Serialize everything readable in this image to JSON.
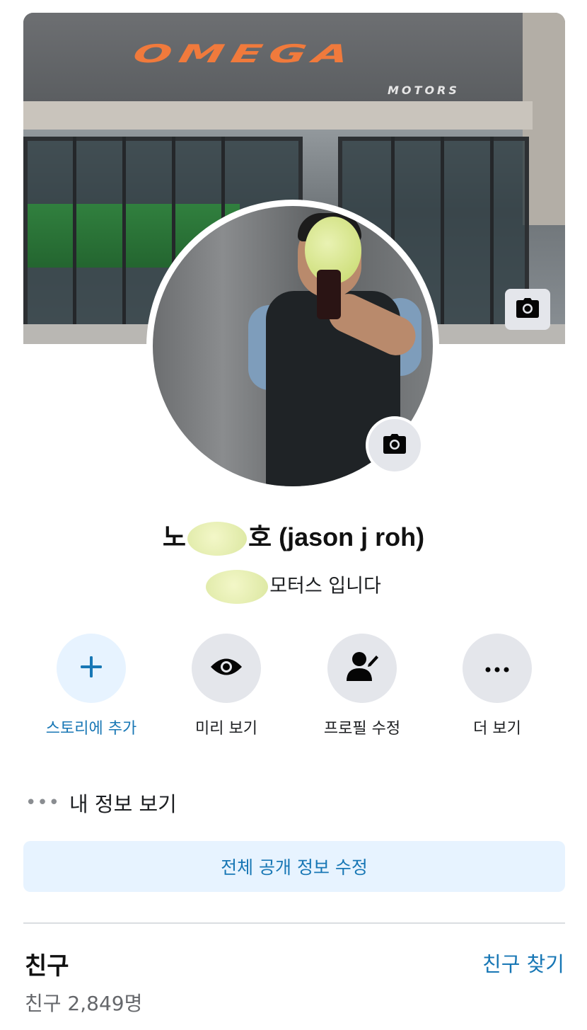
{
  "cover": {
    "logo_text": "OMEGA",
    "logo_sub": "MOTORS"
  },
  "profile": {
    "name_prefix": "노",
    "name_suffix": "호 (jason j roh)",
    "bio_suffix": "모터스 입니다"
  },
  "actions": [
    {
      "label": "스토리에 추가",
      "icon": "plus-icon"
    },
    {
      "label": "미리 보기",
      "icon": "eye-icon"
    },
    {
      "label": "프로필 수정",
      "icon": "edit-profile-icon"
    },
    {
      "label": "더 보기",
      "icon": "more-icon"
    }
  ],
  "more_info": {
    "dots": "•••",
    "label": "내 정보 보기"
  },
  "edit_public_label": "전체 공개 정보 수정",
  "friends": {
    "title": "친구",
    "find_label": "친구 찾기",
    "count_label": "친구 2,849명"
  },
  "colors": {
    "accent": "#1877b5",
    "accent_bg": "#e7f3ff",
    "button_bg": "#e4e6eb",
    "logo_orange": "#f07a3c"
  }
}
